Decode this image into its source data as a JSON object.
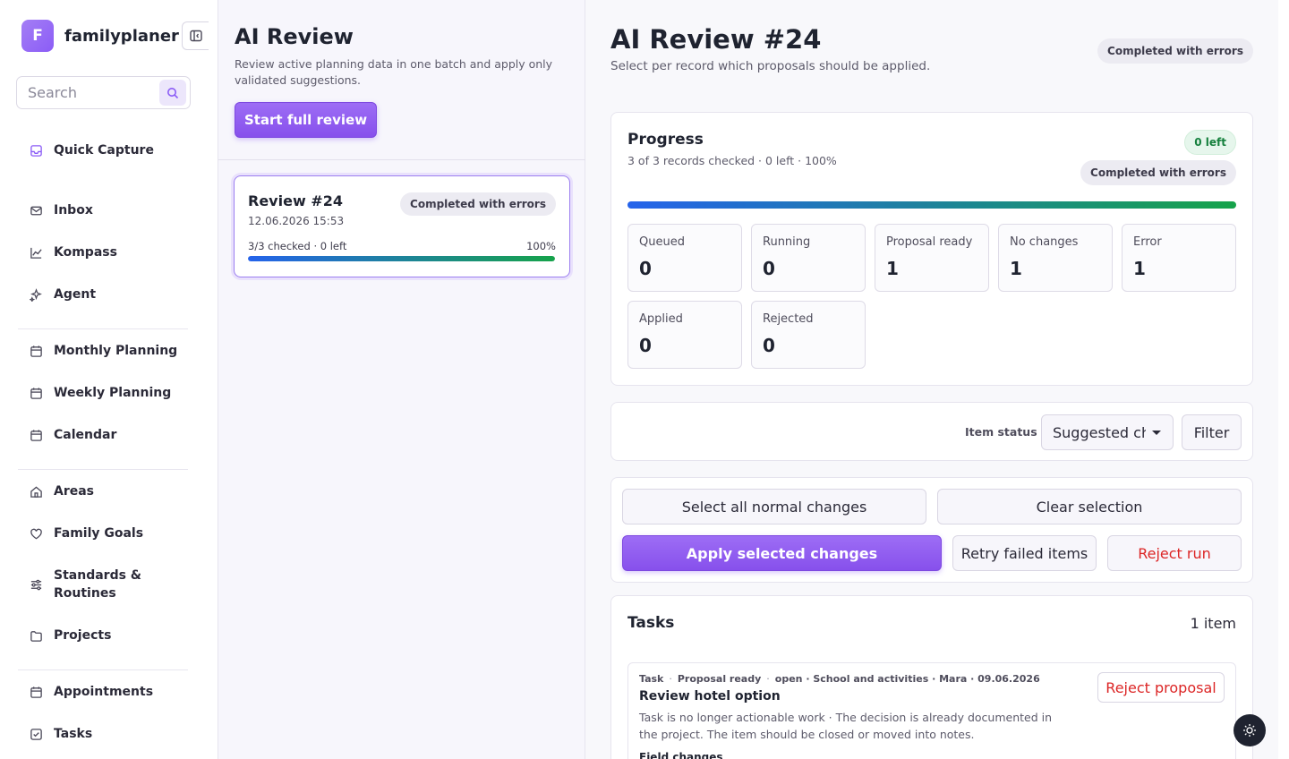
{
  "brand": {
    "logo_letter": "F",
    "name": "familyplaner"
  },
  "search": {
    "placeholder": "Search"
  },
  "nav": {
    "quick_capture": "Quick Capture",
    "inbox": "Inbox",
    "kompass": "Kompass",
    "agent": "Agent",
    "monthly": "Monthly Planning",
    "weekly": "Weekly Planning",
    "calendar": "Calendar",
    "areas": "Areas",
    "family_goals": "Family Goals",
    "standards_line1": "Standards &",
    "standards_line2": "Routines",
    "projects": "Projects",
    "appointments": "Appointments",
    "tasks": "Tasks"
  },
  "middle": {
    "title": "AI Review",
    "subtitle": "Review active planning data in one batch and apply only validated suggestions.",
    "start_button": "Start full review",
    "review": {
      "title": "Review #24",
      "date": "12.06.2026 15:53",
      "status": "Completed with errors",
      "checked": "3/3 checked · 0 left",
      "percent": "100%",
      "progress_fraction": 1.0
    }
  },
  "main": {
    "title": "AI Review #24",
    "subtitle": "Select per record which proposals should be applied.",
    "status": "Completed with errors",
    "progress": {
      "title": "Progress",
      "summary": "3 of 3 records checked · 0 left · 100%",
      "left_badge": "0 left",
      "status_badge": "Completed with errors",
      "fraction": 1.0,
      "stats": [
        {
          "label": "Queued",
          "value": "0"
        },
        {
          "label": "Running",
          "value": "0"
        },
        {
          "label": "Proposal ready",
          "value": "1"
        },
        {
          "label": "No changes",
          "value": "1"
        },
        {
          "label": "Error",
          "value": "1"
        },
        {
          "label": "Applied",
          "value": "0"
        },
        {
          "label": "Rejected",
          "value": "0"
        }
      ]
    },
    "filter": {
      "label": "Item status",
      "selected": "Suggested ch",
      "button": "Filter"
    },
    "actions": {
      "select_all": "Select all normal changes",
      "clear": "Clear selection",
      "apply": "Apply selected changes",
      "retry": "Retry failed items",
      "reject_run": "Reject run"
    },
    "tasks": {
      "title": "Tasks",
      "count": "1 item",
      "item": {
        "type": "Task",
        "state": "Proposal ready",
        "details": "open · School and activities · Mara · 09.06.2026",
        "title": "Review hotel option",
        "description": "Task is no longer actionable work · The decision is already documented in the project. The item should be closed or moved into notes.",
        "field_changes": "Field changes",
        "reject_button": "Reject proposal"
      }
    }
  },
  "colors": {
    "accent": "#8b5cf6",
    "progress_start": "#2563eb",
    "progress_end": "#16a34a",
    "danger": "#dc2626",
    "success": "#15803d"
  },
  "icons": {
    "quick_capture": "inbox-tray-icon",
    "inbox": "envelope-icon",
    "kompass": "line-chart-icon",
    "agent": "sparkles-icon",
    "monthly": "calendar-icon",
    "weekly": "calendar-icon",
    "calendar": "calendar-icon",
    "areas": "home-icon",
    "family_goals": "heart-icon",
    "standards": "sliders-icon",
    "projects": "folder-icon",
    "appointments": "calendar-icon",
    "tasks": "checkbox-icon",
    "theme_toggle": "sun-icon"
  }
}
